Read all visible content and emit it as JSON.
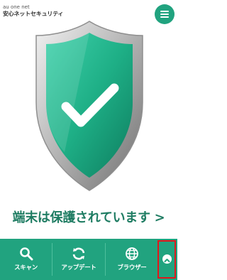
{
  "header": {
    "brand_small": "au one net",
    "brand_title": "安心ネットセキュリティ"
  },
  "status": {
    "message": "端末は保護されています >"
  },
  "nav": {
    "scan": "スキャン",
    "update": "アップデート",
    "browser": "ブラウザー"
  },
  "icons": {
    "menu": "hamburger-menu-icon",
    "shield": "shield-check-icon",
    "scan": "magnifier-icon",
    "update": "refresh-icon",
    "browser": "globe-icon",
    "scroll_top": "chevron-up-icon"
  },
  "colors": {
    "accent": "#21a37f",
    "status_text": "#1e7c62",
    "highlight": "#e0161b"
  }
}
